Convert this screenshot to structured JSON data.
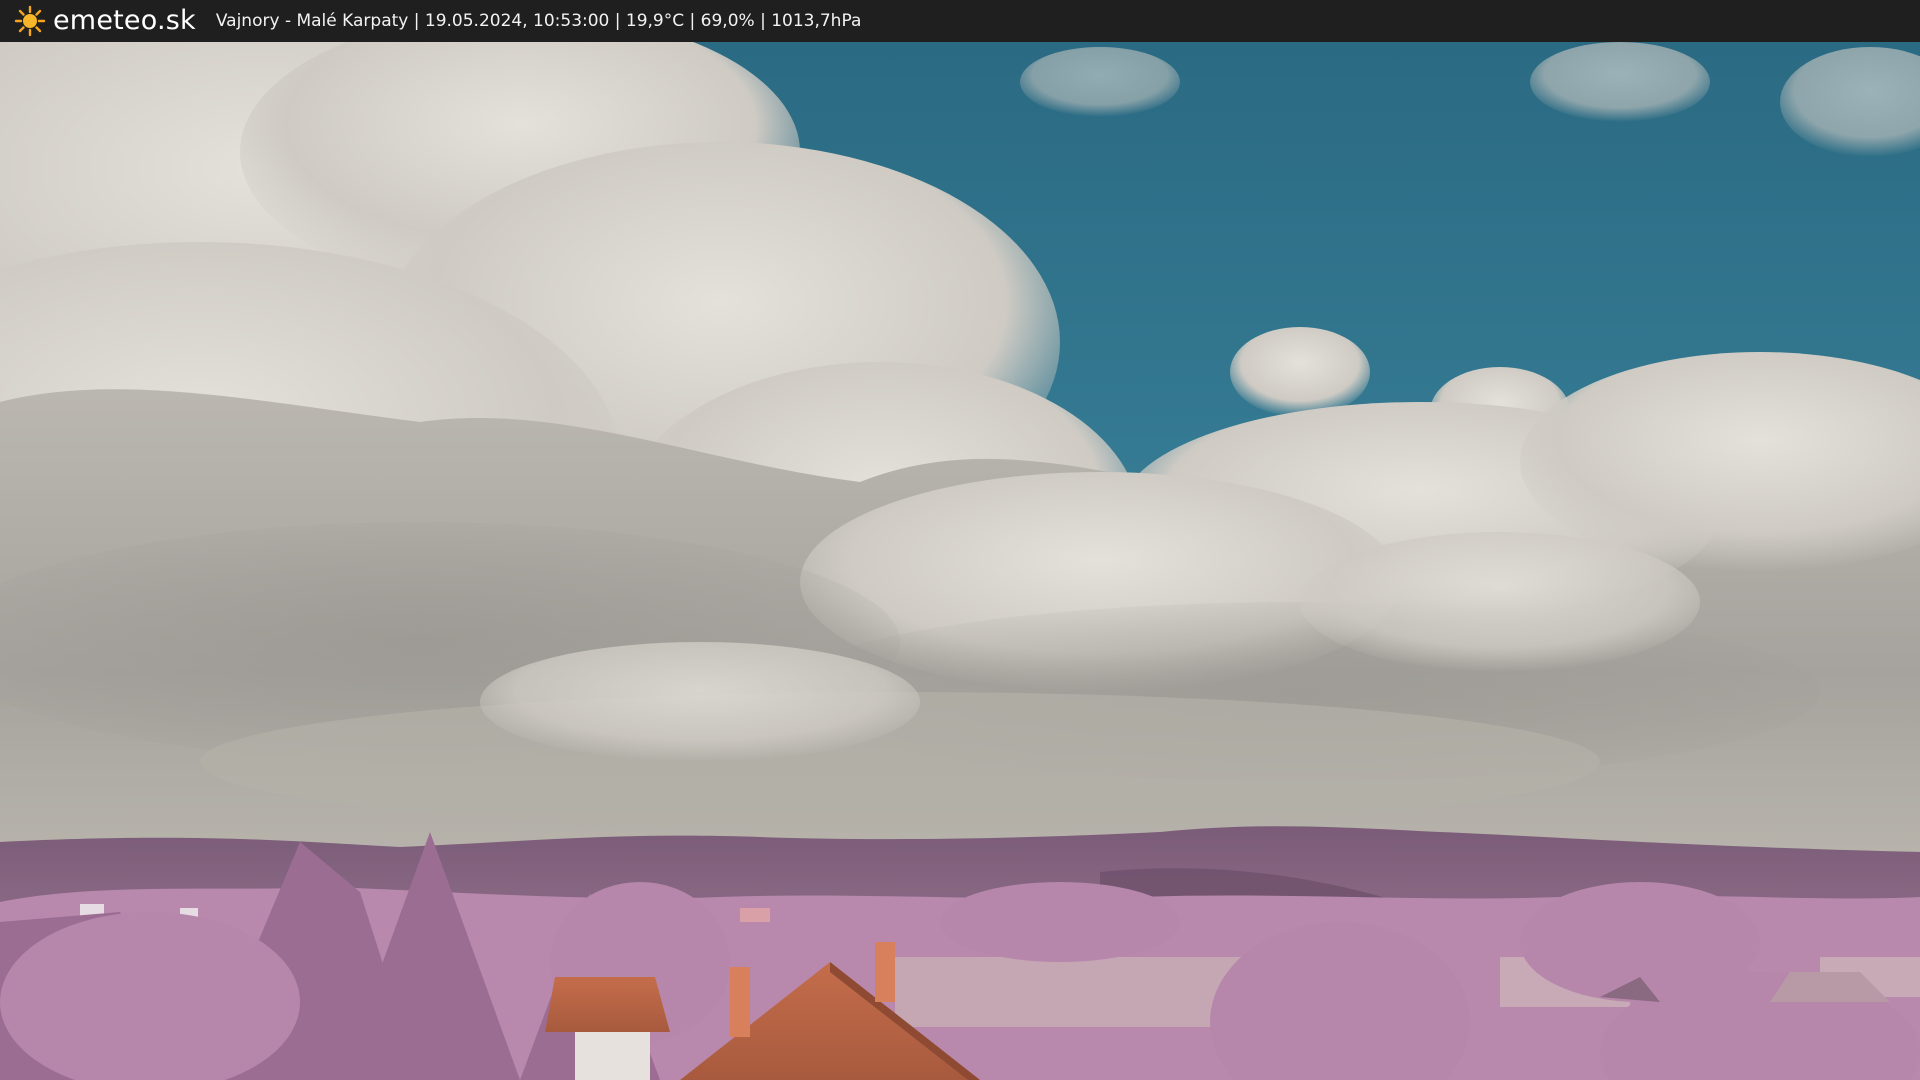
{
  "header": {
    "brand": "emeteo.sk",
    "icon": "sun-icon",
    "caption": "Vajnory - Malé Karpaty | 19.05.2024, 10:53:00 | 19,9°C | 69,0% | 1013,7hPa"
  },
  "colors": {
    "header_bg": "#1f1f1f",
    "sun": "#f5a51e",
    "sky": "#2f6f86",
    "cloud": "#d9d6cf",
    "hills": "#7a5b78",
    "foliage": "#b98aad",
    "roof": "#c06a4a"
  }
}
